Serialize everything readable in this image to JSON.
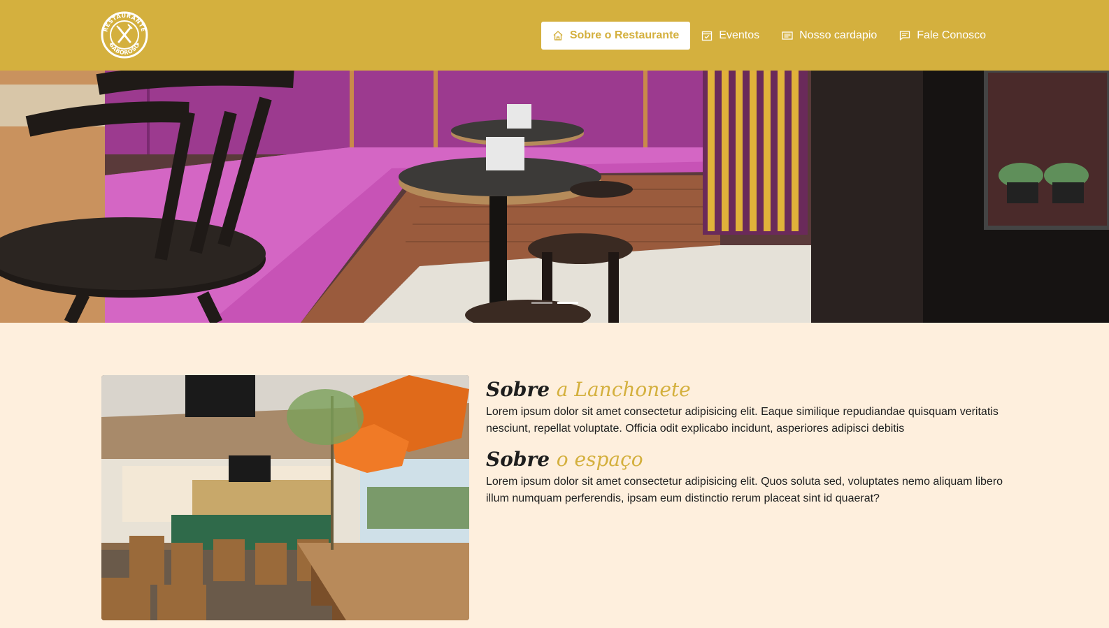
{
  "brand": {
    "logo_top_text": "RESTAURANTE",
    "logo_bottom_text": "SABOROSO"
  },
  "nav": {
    "items": [
      {
        "label": "Sobre o Restaurante",
        "icon": "home-icon",
        "active": true
      },
      {
        "label": "Eventos",
        "icon": "calendar-check-icon",
        "active": false
      },
      {
        "label": "Nosso cardapio",
        "icon": "menu-list-icon",
        "active": false
      },
      {
        "label": "Fale Conosco",
        "icon": "chat-icon",
        "active": false
      }
    ]
  },
  "carousel": {
    "slide_count": 2,
    "active_index": 1
  },
  "about": {
    "section1": {
      "title_main": "Sobre",
      "title_accent": "a Lanchonete",
      "text": "Lorem ipsum dolor sit amet consectetur adipisicing elit. Eaque similique repudiandae quisquam veritatis nesciunt, repellat voluptate. Officia odit explicabo incidunt, asperiores adipisci debitis"
    },
    "section2": {
      "title_main": "Sobre",
      "title_accent": "o espaço",
      "text": "Lorem ipsum dolor sit amet consectetur adipisicing elit. Quos soluta sed, voluptates nemo aliquam libero illum numquam perferendis, ipsam eum distinctio rerum placeat sint id quaerat?"
    }
  },
  "colors": {
    "brand": "#D4B03E",
    "background": "#FEEFDD",
    "text": "#1e1e1e"
  }
}
